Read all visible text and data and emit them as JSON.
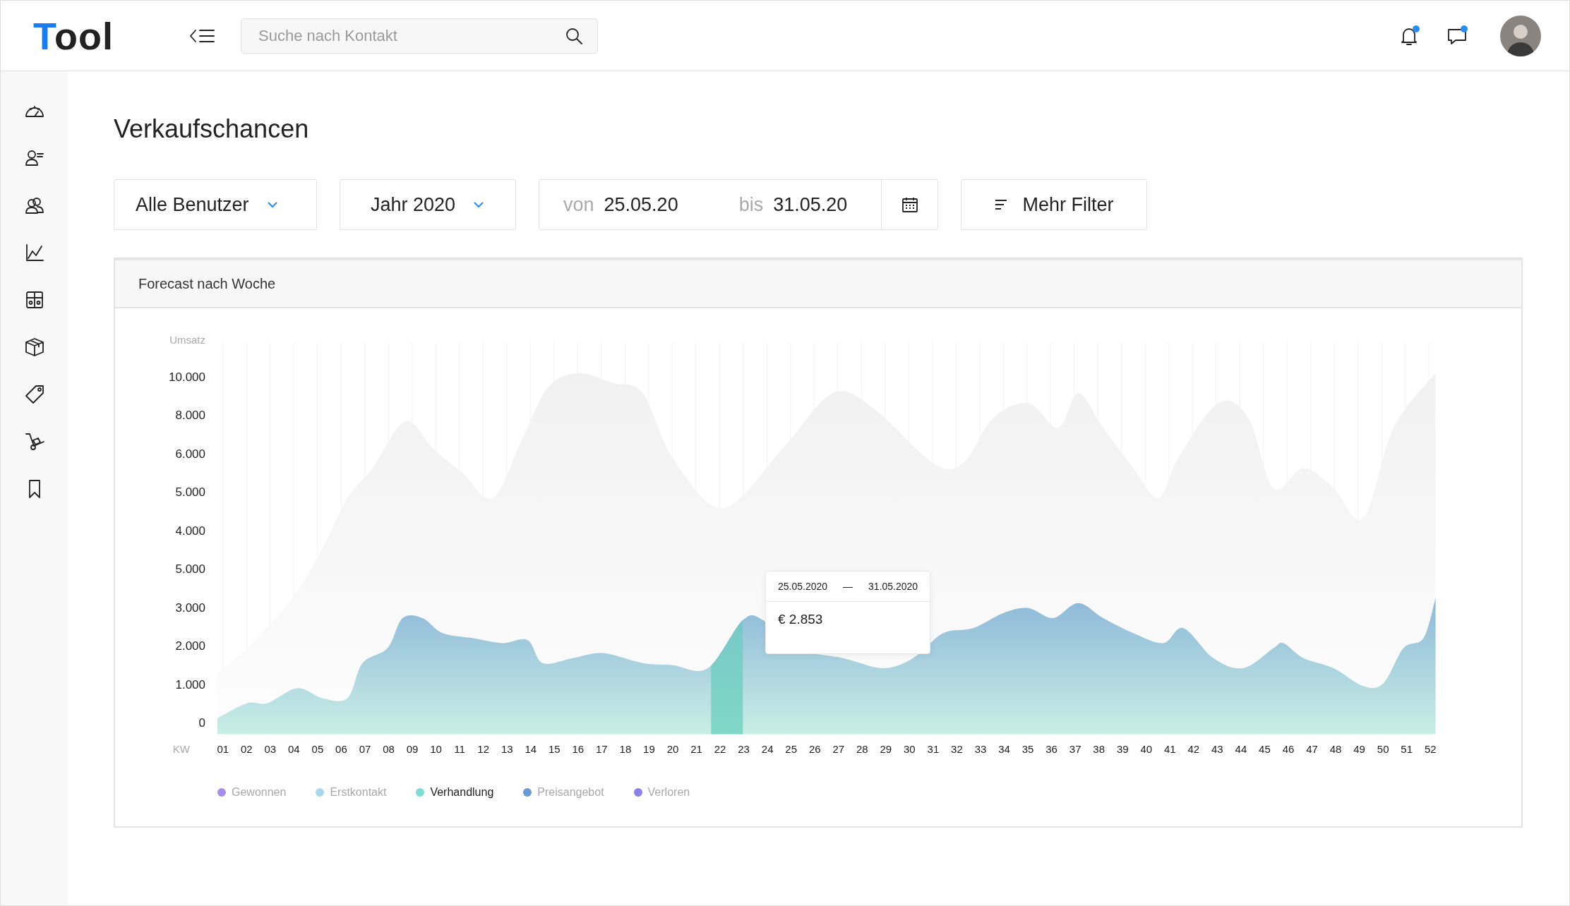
{
  "header": {
    "logo": "Tool",
    "search": {
      "placeholder": "Suche nach Kontakt"
    },
    "notifications": {
      "unread": true
    },
    "messages": {
      "unread": true
    }
  },
  "page_title": "Verkaufschancen",
  "filters": {
    "user_dropdown": "Alle Benutzer",
    "period_dropdown": "Jahr 2020",
    "date_range": {
      "from_label": "von",
      "from": "25.05.20",
      "to_label": "bis",
      "to": "31.05.20"
    },
    "more_button": "Mehr Filter"
  },
  "chart": {
    "title": "Forecast nach Woche",
    "y_axis": {
      "title": "Umsatz",
      "labels": [
        "10.000",
        "8.000",
        "6.000",
        "5.000",
        "4.000",
        "5.000",
        "3.000",
        "2.000",
        "1.000",
        "0"
      ]
    },
    "x_axis": {
      "title": "KW",
      "weeks": [
        {
          "label": "01",
          "selected": false
        },
        {
          "label": "02",
          "selected": false
        },
        {
          "label": "03",
          "selected": false
        },
        {
          "label": "04",
          "selected": false
        },
        {
          "label": "05",
          "selected": false
        },
        {
          "label": "06",
          "selected": false
        },
        {
          "label": "07",
          "selected": false
        },
        {
          "label": "08",
          "selected": false
        },
        {
          "label": "09",
          "selected": false
        },
        {
          "label": "10",
          "selected": false
        },
        {
          "label": "11",
          "selected": false
        },
        {
          "label": "12",
          "selected": false
        },
        {
          "label": "13",
          "selected": false
        },
        {
          "label": "14",
          "selected": false
        },
        {
          "label": "15",
          "selected": false
        },
        {
          "label": "16",
          "selected": false
        },
        {
          "label": "17",
          "selected": false
        },
        {
          "label": "18",
          "selected": false
        },
        {
          "label": "19",
          "selected": false
        },
        {
          "label": "20",
          "selected": false
        },
        {
          "label": "21",
          "selected": false
        },
        {
          "label": "22",
          "selected": true
        },
        {
          "label": "23",
          "selected": false
        },
        {
          "label": "24",
          "selected": false
        },
        {
          "label": "25",
          "selected": false
        },
        {
          "label": "26",
          "selected": false
        },
        {
          "label": "27",
          "selected": false
        },
        {
          "label": "28",
          "selected": false
        },
        {
          "label": "29",
          "selected": false
        },
        {
          "label": "30",
          "selected": false
        },
        {
          "label": "31",
          "selected": false
        },
        {
          "label": "32",
          "selected": false
        },
        {
          "label": "33",
          "selected": false
        },
        {
          "label": "34",
          "selected": false
        },
        {
          "label": "35",
          "selected": false
        },
        {
          "label": "36",
          "selected": false
        },
        {
          "label": "37",
          "selected": false
        },
        {
          "label": "38",
          "selected": false
        },
        {
          "label": "39",
          "selected": false
        },
        {
          "label": "40",
          "selected": false
        },
        {
          "label": "41",
          "selected": false
        },
        {
          "label": "42",
          "selected": false
        },
        {
          "label": "43",
          "selected": false
        },
        {
          "label": "44",
          "selected": false
        },
        {
          "label": "45",
          "selected": false
        },
        {
          "label": "46",
          "selected": false
        },
        {
          "label": "47",
          "selected": false
        },
        {
          "label": "48",
          "selected": false
        },
        {
          "label": "49",
          "selected": false
        },
        {
          "label": "50",
          "selected": false
        },
        {
          "label": "51",
          "selected": false
        },
        {
          "label": "52",
          "selected": false
        }
      ]
    },
    "tooltip": {
      "from": "25.05.2020",
      "separator": "—",
      "to": "31.05.2020",
      "value": "€ 2.853"
    },
    "legend": [
      {
        "label": "Gewonnen",
        "color": "#a98ee8",
        "selected": false
      },
      {
        "label": "Erstkontakt",
        "color": "#a8d8ea",
        "selected": false
      },
      {
        "label": "Verhandlung",
        "color": "#7ddfd3",
        "selected": true
      },
      {
        "label": "Preisangebot",
        "color": "#6a9bd8",
        "selected": false
      },
      {
        "label": "Verloren",
        "color": "#8b82e6",
        "selected": false
      }
    ]
  }
}
